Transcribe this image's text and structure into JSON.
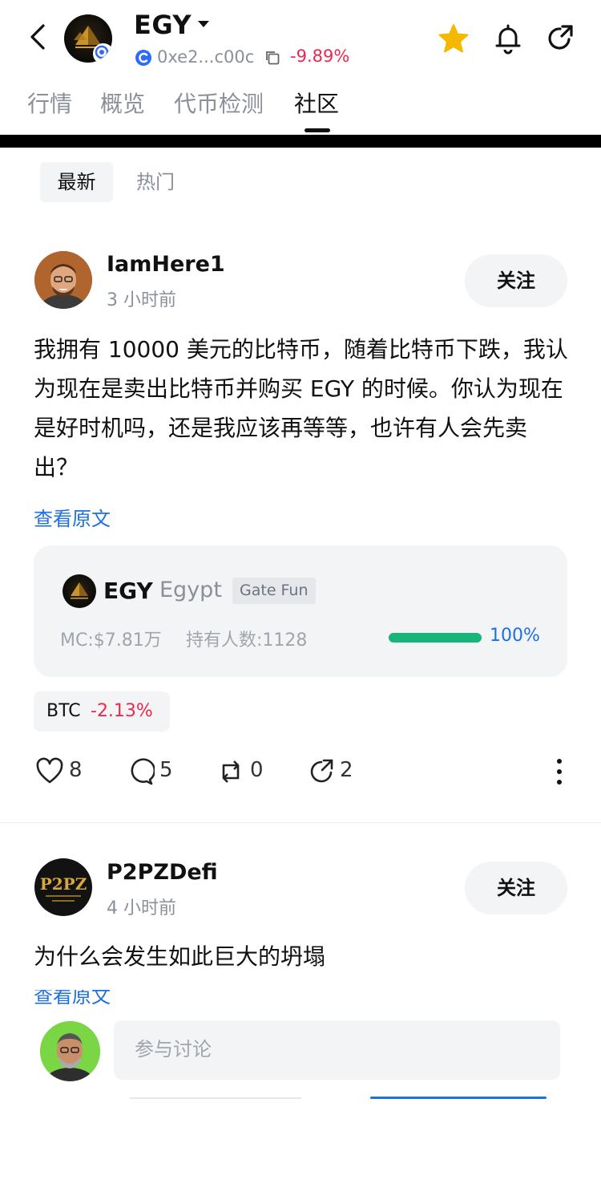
{
  "header": {
    "token_symbol": "EGY",
    "contract_short": "0xe2...c00c",
    "price_change": "-9.89%"
  },
  "tabs": [
    {
      "label": "行情",
      "active": false
    },
    {
      "label": "概览",
      "active": false
    },
    {
      "label": "代币检测",
      "active": false
    },
    {
      "label": "社区",
      "active": true
    }
  ],
  "filters": {
    "latest": "最新",
    "hot": "热门"
  },
  "posts": [
    {
      "username": "IamHere1",
      "time": "3 小时前",
      "follow_label": "关注",
      "content": "我拥有 10000 美元的比特币，随着比特币下跌，我认为现在是卖出比特币并购买 EGY 的时候。你认为现在是好时机吗，还是我应该再等等，也许有人会先卖出？",
      "translate_label": "查看原文",
      "token_card": {
        "symbol": "EGY",
        "name": "Egypt",
        "tag": "Gate Fun",
        "market_cap": "MC:$7.81万",
        "holders": "持有人数:1128",
        "progress_percent": 100,
        "progress_label": "100%"
      },
      "mention": {
        "symbol": "BTC",
        "change": "-2.13%"
      },
      "actions": {
        "likes": "8",
        "comments": "5",
        "reposts": "0",
        "shares": "2"
      }
    },
    {
      "username": "P2PZDefi",
      "time": "4 小时前",
      "follow_label": "关注",
      "content": "为什么会发生如此巨大的坍塌",
      "translate_label": "查看原文",
      "avatar_text": "P2PZ"
    }
  ],
  "composer": {
    "placeholder": "参与讨论"
  },
  "colors": {
    "negative": "#f0264f",
    "link": "#1d6fe6",
    "progress": "#17b579",
    "star": "#f5b800"
  },
  "icons": [
    "back-arrow-icon",
    "chevron-down-icon",
    "chain-icon",
    "copy-icon",
    "star-icon",
    "bell-icon",
    "share-icon",
    "heart-icon",
    "comment-icon",
    "repost-icon",
    "share-icon",
    "more-vertical-icon"
  ]
}
